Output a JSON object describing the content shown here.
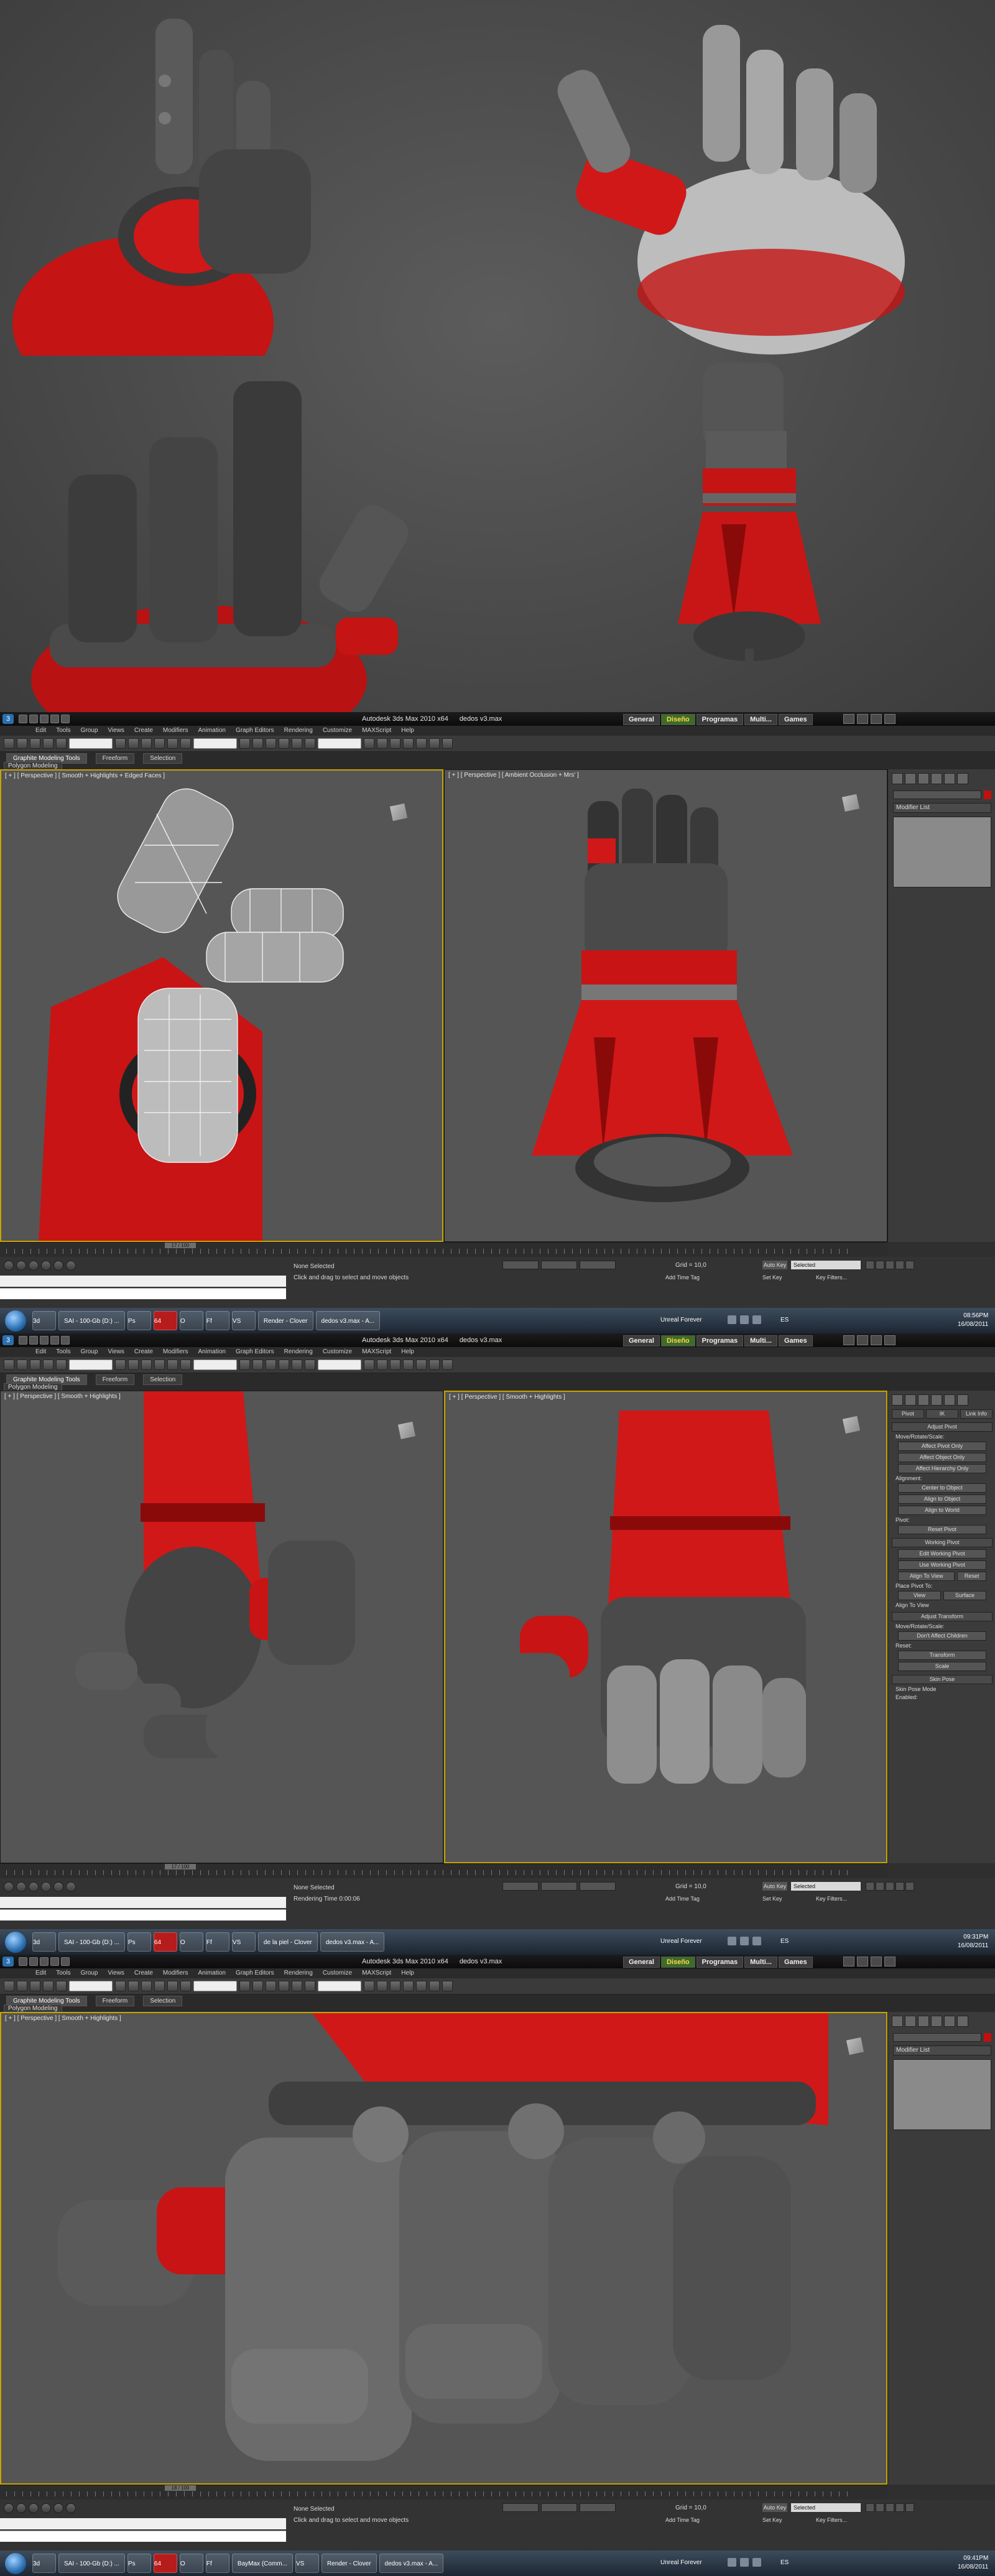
{
  "app": {
    "logo_text": "3",
    "window_title": "Autodesk 3ds Max 2010 x64",
    "file_name": "dedos v3.max"
  },
  "workspaces": [
    {
      "label": "General",
      "active": false
    },
    {
      "label": "Diseño",
      "active": true
    },
    {
      "label": "Programas",
      "active": false
    },
    {
      "label": "Multi...",
      "active": false
    },
    {
      "label": "Games",
      "active": false
    }
  ],
  "menu": [
    "Edit",
    "Tools",
    "Group",
    "Views",
    "Create",
    "Modifiers",
    "Animation",
    "Graph Editors",
    "Rendering",
    "Customize",
    "MAXScript",
    "Help"
  ],
  "ribbon": {
    "tabs": [
      "Graphite Modeling Tools",
      "Freeform",
      "Selection"
    ],
    "sub_label": "Polygon Modeling"
  },
  "shots": [
    {
      "viewports": [
        {
          "label": "[ + ] [ Perspective ] [ Smooth + Highlights + Edged Faces ]"
        },
        {
          "label": "[ + ] [ Perspective ] [ Ambient Occlusion + Mrs' ]"
        }
      ],
      "command_panel": {
        "mode": "modify",
        "modifier_list": "Modifier List"
      },
      "track": {
        "frame": "17 / 100"
      },
      "status": {
        "line1": "None Selected",
        "line2": "Click and drag to select and move objects"
      },
      "grid": "Grid = 10,0",
      "taskbar": {
        "items": [
          "3d",
          "SAI - 100-Gb (D:) ...",
          "Ps",
          "64",
          "O",
          "Ff",
          "VS",
          "Render - Clover",
          "dedos v3.max - A..."
        ],
        "unreal": "Unreal Forever",
        "es": "ES",
        "time": "08:56PM",
        "date": "16/08/2011"
      }
    },
    {
      "viewports": [
        {
          "label": "[ + ] [ Perspective ] [ Smooth + Highlights ]"
        },
        {
          "label": "[ + ] [ Perspective ] [ Smooth + Highlights ]"
        }
      ],
      "command_panel": {
        "mode": "hierarchy",
        "tabs": [
          "Pivot",
          "IK",
          "Link Info"
        ],
        "adjust_pivot": "Adjust Pivot",
        "move_rotate_scale": "Move/Rotate/Scale:",
        "buttons1": [
          "Affect Pivot Only",
          "Affect Object Only",
          "Affect Hierarchy Only"
        ],
        "alignment": "Alignment:",
        "buttons2": [
          "Center to Object",
          "Align to Object",
          "Align to World"
        ],
        "pivot": "Pivot:",
        "reset_pivot": "Reset Pivot",
        "working_pivot": "Working Pivot",
        "buttons3": [
          "Edit Working Pivot",
          "Use Working Pivot"
        ],
        "align_to_view": "Align To View",
        "reset": "Reset",
        "place_pivot_to": "Place Pivot To:",
        "view": "View",
        "surface": "Surface",
        "align_to_view_check": "Align To View",
        "adjust_transform": "Adjust Transform",
        "dont_affect_children": "Don't Affect Children",
        "reset_label": "Reset:",
        "transform": "Transform",
        "scale": "Scale",
        "skin_pose": "Skin Pose",
        "skin_pose_mode": "Skin Pose Mode",
        "enabled": "Enabled:"
      },
      "track": {
        "frame": "17 / 100"
      },
      "status": {
        "line1": "None Selected",
        "line2": "Rendering Time 0:00:06"
      },
      "grid": "Grid = 10,0",
      "taskbar": {
        "items": [
          "3d",
          "SAI - 100-Gb (D:) ...",
          "Ps",
          "64",
          "O",
          "Ff",
          "VS",
          "de la piel - Clover",
          "dedos v3.max - A..."
        ],
        "unreal": "Unreal Forever",
        "es": "ES",
        "time": "09:31PM",
        "date": "16/08/2011"
      }
    },
    {
      "viewports": [
        {
          "label": "[ + ] [ Perspective ] [ Smooth + Highlights ]"
        }
      ],
      "command_panel": {
        "mode": "modify",
        "modifier_list": "Modifier List"
      },
      "track": {
        "frame": "18 / 100"
      },
      "status": {
        "line1": "None Selected",
        "line2": "Click and drag to select and move objects"
      },
      "grid": "Grid = 10,0",
      "taskbar": {
        "items": [
          "3d",
          "SAI - 100-Gb (D:) ...",
          "Ps",
          "64",
          "O",
          "Ff",
          "BayMax (Comm...",
          "VS",
          "Render - Clover",
          "dedos v3.max - A..."
        ],
        "unreal": "Unreal Forever",
        "es": "ES",
        "time": "09:41PM",
        "date": "16/08/2011"
      }
    }
  ],
  "autokey": "Auto Key",
  "selected": "Selected",
  "add_time_tag": "Add Time Tag",
  "set_key": "Set Key",
  "key_filters": "Key Filters...",
  "colors": {
    "armor_red": "#d01818",
    "metal_grey": "#6a6a6a",
    "viewport_bg": "#555555",
    "active_border": "#c8a400"
  }
}
